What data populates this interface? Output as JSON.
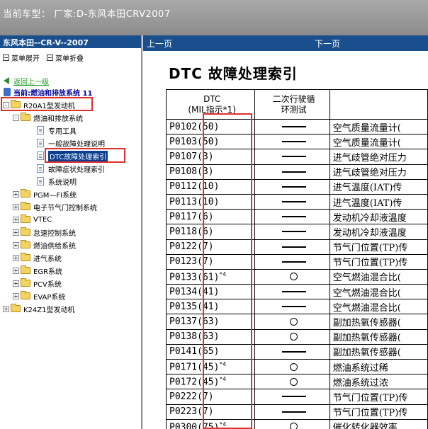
{
  "window": {
    "title": "当前车型： 厂家:D-东风本田CRV2007"
  },
  "left_panel": {
    "header": "东风本田--CR-V--2007",
    "toolbar": {
      "expand": "菜单展开",
      "collapse": "菜单折叠"
    },
    "back_link": "返回上一级",
    "current_position": "当前:燃油和排放系统 11",
    "tree": [
      {
        "label": "R20A1型发动机",
        "kind": "folder",
        "pm": "-"
      },
      {
        "label": "燃油和排放系统",
        "kind": "folder",
        "pm": "-"
      },
      {
        "label": "专用工具",
        "kind": "doc"
      },
      {
        "label": "一般故障处理说明",
        "kind": "doc"
      },
      {
        "label": "DTC故障处理索引",
        "kind": "doc",
        "selected": true
      },
      {
        "label": "故障症状处理索引",
        "kind": "doc"
      },
      {
        "label": "系统说明",
        "kind": "doc"
      },
      {
        "label": "PGM—FI系统",
        "kind": "folder",
        "pm": "+"
      },
      {
        "label": "电子节气门控制系统",
        "kind": "folder",
        "pm": "+"
      },
      {
        "label": "VTEC",
        "kind": "folder",
        "pm": "+"
      },
      {
        "label": "怠速控制系统",
        "kind": "folder",
        "pm": "+"
      },
      {
        "label": "燃油供给系统",
        "kind": "folder",
        "pm": "+"
      },
      {
        "label": "进气系统",
        "kind": "folder",
        "pm": "+"
      },
      {
        "label": "EGR系统",
        "kind": "folder",
        "pm": "+"
      },
      {
        "label": "PCV系统",
        "kind": "folder",
        "pm": "+"
      },
      {
        "label": "EVAP系统",
        "kind": "folder",
        "pm": "+"
      },
      {
        "label": "K24Z1型发动机",
        "kind": "folder",
        "pm": "+"
      }
    ]
  },
  "right_panel": {
    "nav": {
      "prev": "上一页",
      "next": "下一页"
    },
    "title": "DTC 故障处理索引",
    "table": {
      "headers": [
        "DTC\n(MIL指示*1)",
        "二次行驶循\n环测试",
        ""
      ],
      "rows": [
        {
          "code": "P0102",
          "mil": "(50)",
          "sup": "",
          "two_trip": "dash",
          "desc": "空气质量流量计("
        },
        {
          "code": "P0103",
          "mil": "(50)",
          "sup": "",
          "two_trip": "dash",
          "desc": "空气质量流量计("
        },
        {
          "code": "P0107",
          "mil": "(3)",
          "sup": "",
          "two_trip": "dash",
          "desc": "进气歧管绝对压力"
        },
        {
          "code": "P0108",
          "mil": "(3)",
          "sup": "",
          "two_trip": "dash",
          "desc": "进气歧管绝对压力"
        },
        {
          "code": "P0112",
          "mil": "(10)",
          "sup": "",
          "two_trip": "dash",
          "desc": "进气温度(IAT)传"
        },
        {
          "code": "P0113",
          "mil": "(10)",
          "sup": "",
          "two_trip": "dash",
          "desc": "进气温度(IAT)传"
        },
        {
          "code": "P0117",
          "mil": "(6)",
          "sup": "",
          "two_trip": "dash",
          "desc": "发动机冷却液温度"
        },
        {
          "code": "P0118",
          "mil": "(6)",
          "sup": "",
          "two_trip": "dash",
          "desc": "发动机冷却液温度"
        },
        {
          "code": "P0122",
          "mil": "(7)",
          "sup": "",
          "two_trip": "dash",
          "desc": "节气门位置(TP)传"
        },
        {
          "code": "P0123",
          "mil": "(7)",
          "sup": "",
          "two_trip": "dash",
          "desc": "节气门位置(TP)传"
        },
        {
          "code": "P0133",
          "mil": "(61)",
          "sup": "*4",
          "two_trip": "circle",
          "desc": "空气燃油混合比("
        },
        {
          "code": "P0134",
          "mil": "(41)",
          "sup": "",
          "two_trip": "dash",
          "desc": "空气燃油混合比("
        },
        {
          "code": "P0135",
          "mil": "(41)",
          "sup": "",
          "two_trip": "dash",
          "desc": "空气燃油混合比("
        },
        {
          "code": "P0137",
          "mil": "(63)",
          "sup": "",
          "two_trip": "circle",
          "desc": "副加热氧传感器("
        },
        {
          "code": "P0138",
          "mil": "(63)",
          "sup": "",
          "two_trip": "circle",
          "desc": "副加热氧传感器("
        },
        {
          "code": "P0141",
          "mil": "(65)",
          "sup": "",
          "two_trip": "dash",
          "desc": "副加热氧传感器("
        },
        {
          "code": "P0171",
          "mil": "(45)",
          "sup": "*4",
          "two_trip": "circle",
          "desc": "燃油系统过稀"
        },
        {
          "code": "P0172",
          "mil": "(45)",
          "sup": "*4",
          "two_trip": "circle",
          "desc": "燃油系统过浓"
        },
        {
          "code": "P0222",
          "mil": "(7)",
          "sup": "",
          "two_trip": "dash",
          "desc": "节气门位置(TP)传"
        },
        {
          "code": "P0223",
          "mil": "(7)",
          "sup": "",
          "two_trip": "dash",
          "desc": "节气门位置(TP)传"
        },
        {
          "code": "P0300",
          "mil": "(75)",
          "sup": "*4",
          "two_trip": "circle",
          "desc": "催化转化器效率"
        }
      ]
    }
  }
}
